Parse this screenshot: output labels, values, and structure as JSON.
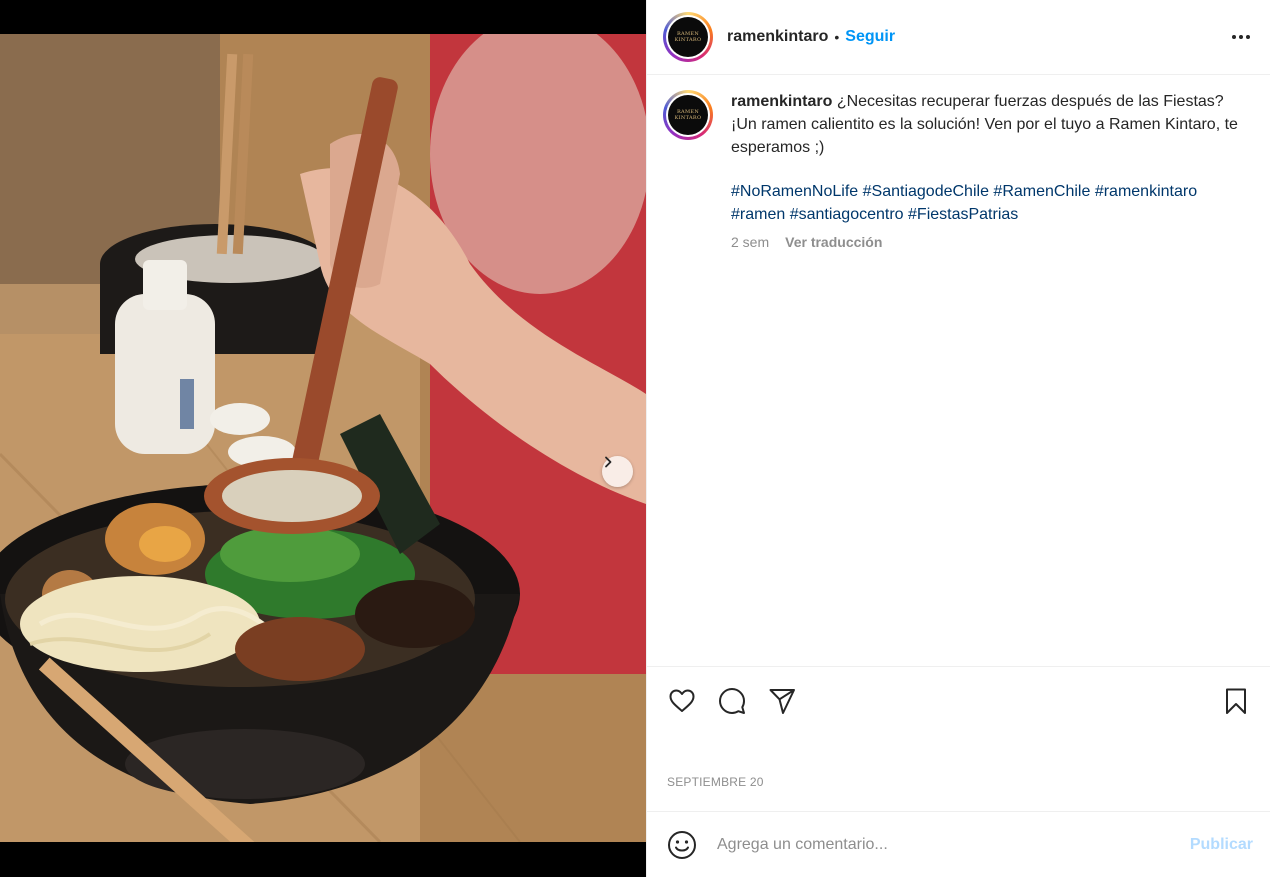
{
  "post": {
    "username": "ramenkintaro",
    "follow_label": "Seguir",
    "avatar_logo_lines": [
      "RAMEN",
      "KINTARO"
    ],
    "caption_text": "¿Necesitas recuperar fuerzas después de las Fiestas?",
    "caption_text_2": "¡Un ramen calientito es la solución! Ven por el tuyo a Ramen Kintaro, te esperamos ;)",
    "hashtags": [
      "#NoRamenNoLife",
      "#SantiagodeChile",
      "#RamenChile",
      "#ramenkintaro",
      "#ramen",
      "#santiagocentro",
      "#FiestasPatrias"
    ],
    "time_ago": "2 sem",
    "translate_label": "Ver traducción",
    "date": "SEPTIEMBRE 20"
  },
  "comment": {
    "placeholder": "Agrega un comentario...",
    "publish_label": "Publicar"
  },
  "carousel": {
    "slide_count": 3,
    "active_index": 0
  },
  "colors": {
    "link_blue": "#0095f6",
    "hashtag_blue": "#00376b",
    "publish_disabled": "#b3dbff",
    "muted": "#8e8e8e"
  },
  "icons": [
    "more-options-icon",
    "heart-icon",
    "comment-icon",
    "share-icon",
    "bookmark-icon",
    "emoji-icon",
    "chevron-right-icon"
  ]
}
